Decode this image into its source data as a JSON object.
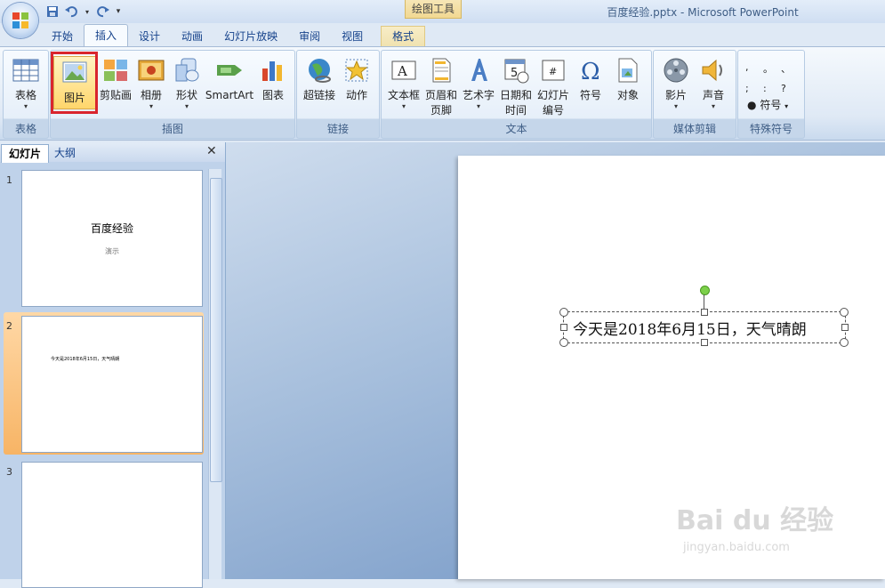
{
  "window": {
    "title": "百度经验.pptx - Microsoft PowerPoint",
    "contextual_tool": "绘图工具"
  },
  "tabs": [
    "开始",
    "插入",
    "设计",
    "动画",
    "幻灯片放映",
    "审阅",
    "视图",
    "格式"
  ],
  "active_tab": "插入",
  "ribbon": {
    "groups": {
      "tables": "表格",
      "illustrations": "插图",
      "links": "链接",
      "text": "文本",
      "media": "媒体剪辑",
      "symbols": "特殊符号"
    },
    "buttons": {
      "table": "表格",
      "picture": "图片",
      "clipart": "剪贴画",
      "album": "相册",
      "shapes": "形状",
      "smartart": "SmartArt",
      "chart": "图表",
      "hyperlink": "超链接",
      "action": "动作",
      "textbox": "文本框",
      "header_footer_1": "页眉和",
      "header_footer_2": "页脚",
      "wordart": "艺术字",
      "datetime_1": "日期和",
      "datetime_2": "时间",
      "slidenum_1": "幻灯片",
      "slidenum_2": "编号",
      "symbol": "符号",
      "object": "对象",
      "movie": "影片",
      "sound": "声音",
      "special_symbol": "符号"
    },
    "special_chars": [
      ",",
      "。",
      "、",
      ";",
      ":",
      "?"
    ],
    "highlight_color": "#d9252d"
  },
  "slides_panel": {
    "tab_slides": "幻灯片",
    "tab_outline": "大纲",
    "close": "✕",
    "slides": [
      {
        "num": "1",
        "title": "百度经验",
        "subtitle": "演示"
      },
      {
        "num": "2",
        "text": "今天是2018年6月15日，天气晴朗"
      },
      {
        "num": "3"
      }
    ]
  },
  "editor": {
    "textbox_text": "今天是2018年6月15日，天气晴朗"
  },
  "watermark": {
    "main": "Bai  du 经验",
    "sub": "jingyan.baidu.com"
  }
}
